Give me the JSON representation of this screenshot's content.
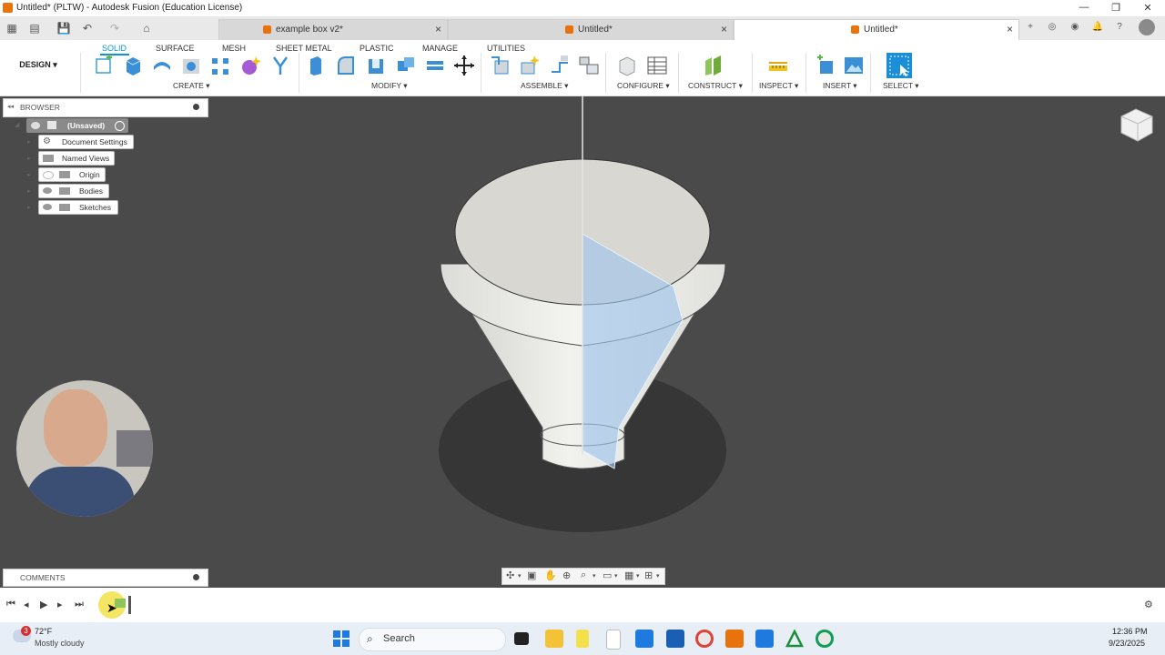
{
  "window": {
    "title": "Untitled* (PLTW) - Autodesk Fusion (Education License)",
    "minimize": "—",
    "restore": "❐",
    "close": "✕"
  },
  "tabs": [
    {
      "label": "example box v2*",
      "active": false,
      "icon_color": "#e8720c"
    },
    {
      "label": "Untitled*",
      "active": false,
      "icon_color": "#e8720c"
    },
    {
      "label": "Untitled*",
      "active": true,
      "icon_color": "#e8720c"
    }
  ],
  "ribbon": {
    "tabs": [
      "SOLID",
      "SURFACE",
      "MESH",
      "SHEET METAL",
      "PLASTIC",
      "MANAGE",
      "UTILITIES"
    ],
    "active_tab": "SOLID",
    "workspace": "DESIGN ▾",
    "groups": [
      "CREATE ▾",
      "MODIFY ▾",
      "ASSEMBLE ▾",
      "CONFIGURE ▾",
      "CONSTRUCT ▾",
      "INSPECT ▾",
      "INSERT ▾",
      "SELECT ▾"
    ],
    "accent": "#0696d7"
  },
  "browser": {
    "title": "BROWSER",
    "root": "(Unsaved)",
    "items": [
      "Document Settings",
      "Named Views",
      "Origin",
      "Bodies",
      "Sketches"
    ]
  },
  "comments": {
    "title": "COMMENTS"
  },
  "taskbar": {
    "weather_temp": "72°F",
    "weather_desc": "Mostly cloudy",
    "weather_badge": "3",
    "search": "Search",
    "time": "12:36 PM",
    "date": "9/23/2025"
  }
}
